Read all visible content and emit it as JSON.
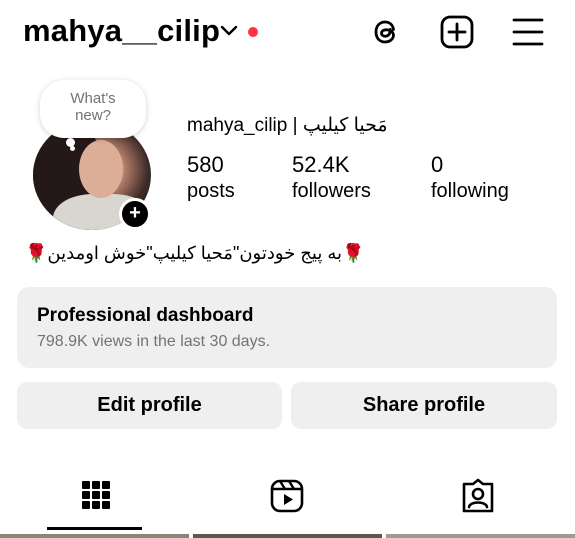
{
  "header": {
    "username": "mahya__cilip",
    "icons": [
      "chevron-down-icon",
      "threads-icon",
      "create-plus-icon",
      "menu-icon"
    ],
    "notification_dot_color": "#ff3040"
  },
  "profile": {
    "note": "What's new?",
    "display_name": "mahya_cilip | مَحیا کیلیپ",
    "stats": {
      "posts_count": "580",
      "posts_label": "posts",
      "followers_count": "52.4K",
      "followers_label": "followers",
      "following_count": "0",
      "following_label": "following"
    },
    "bio": "🌹به پیج خودتون\"مَحیا کیلیپ\"خوش اومدین🌹",
    "add_story_symbol": "+"
  },
  "dashboard": {
    "title": "Professional dashboard",
    "subtitle": "798.9K views in the last 30 days."
  },
  "actions": {
    "edit_label": "Edit profile",
    "share_label": "Share profile"
  },
  "tabs": {
    "items": [
      "grid-icon",
      "reels-icon",
      "tagged-icon"
    ],
    "active": "grid-icon"
  }
}
